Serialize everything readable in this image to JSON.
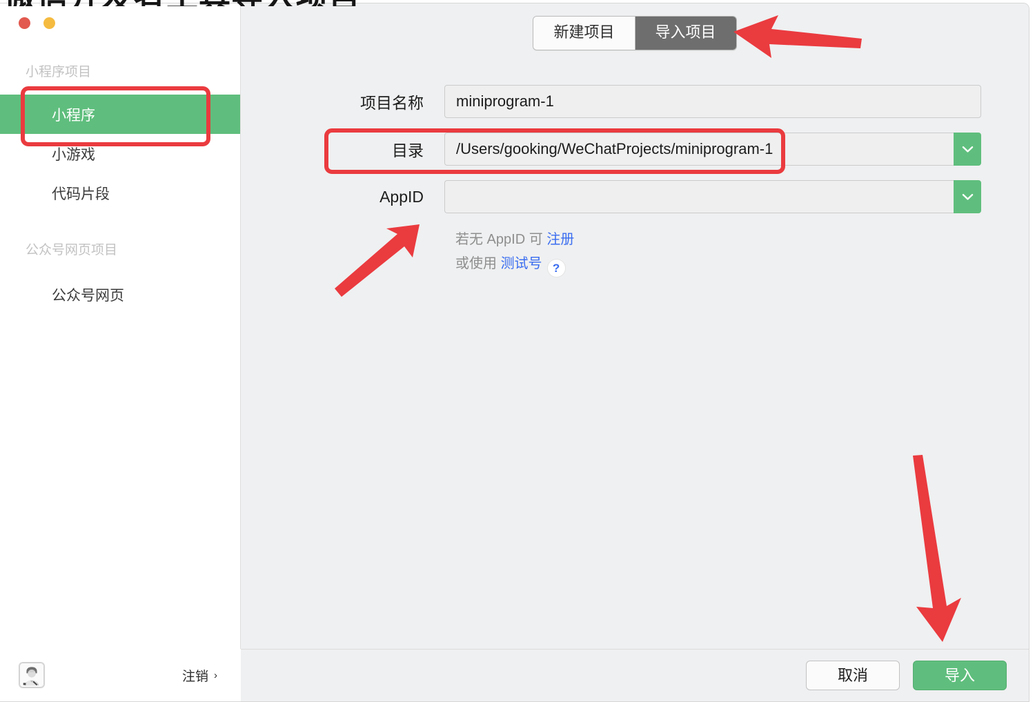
{
  "window": {
    "cutoff_heading": "微信开发者工具导入项目",
    "traffic_lights": {
      "close": "close-button",
      "minimize": "minimize-button"
    }
  },
  "sidebar": {
    "groups": [
      {
        "title": "小程序项目",
        "items": [
          {
            "label": "小程序",
            "active": true
          },
          {
            "label": "小游戏",
            "active": false
          },
          {
            "label": "代码片段",
            "active": false
          }
        ]
      },
      {
        "title": "公众号网页项目",
        "items": [
          {
            "label": "公众号网页",
            "active": false
          }
        ]
      }
    ],
    "bottom": {
      "avatar_alt": "user-avatar",
      "logout_label": "注销",
      "logout_chevron": "›"
    }
  },
  "main": {
    "tabs": [
      {
        "label": "新建项目",
        "active": false
      },
      {
        "label": "导入项目",
        "active": true
      }
    ],
    "form": {
      "fields": [
        {
          "label": "项目名称",
          "value": "miniprogram-1",
          "placeholder": "",
          "has_dropdown": false
        },
        {
          "label": "目录",
          "value": "/Users/gooking/WeChatProjects/miniprogram-1",
          "placeholder": "",
          "has_dropdown": true
        },
        {
          "label": "AppID",
          "value": "",
          "placeholder": "",
          "has_dropdown": true
        }
      ]
    },
    "hint": {
      "line1_prefix": "若无 AppID 可 ",
      "line1_link": "注册",
      "line2_prefix": "或使用 ",
      "line2_link": "测试号",
      "help_glyph": "?"
    },
    "footer": {
      "cancel_label": "取消",
      "import_label": "导入"
    }
  },
  "annotations": {
    "arrows": [
      {
        "name": "arrow-to-import-tab",
        "direction": "left"
      },
      {
        "name": "arrow-to-appid-field",
        "direction": "up-right"
      },
      {
        "name": "arrow-to-import-button",
        "direction": "down"
      }
    ],
    "boxes": [
      {
        "name": "highlight-sidebar-miniprogram"
      },
      {
        "name": "highlight-directory-field"
      }
    ],
    "color": "#ea3b3f"
  },
  "colors": {
    "accent_green": "#5fbe7d",
    "annotation_red": "#ea3b3f",
    "link_blue": "#3a6df0",
    "panel_bg": "#eff0f1",
    "tab_active_bg": "#6e6e6e"
  }
}
